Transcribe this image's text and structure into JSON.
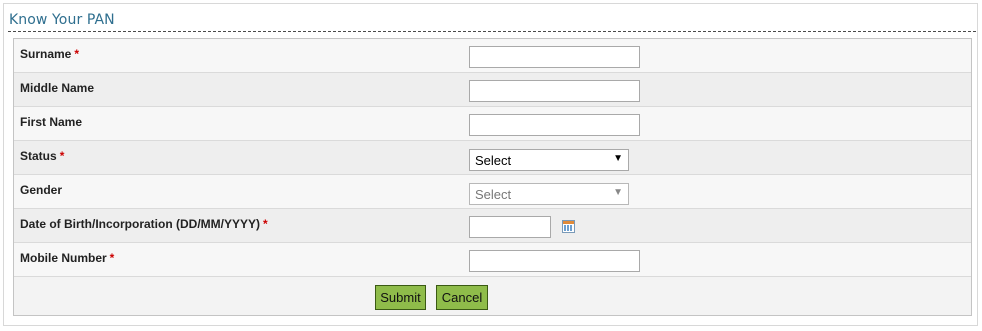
{
  "page": {
    "title": "Know Your PAN"
  },
  "form": {
    "surname": {
      "label": "Surname",
      "required_mark": "*",
      "value": ""
    },
    "middle_name": {
      "label": "Middle Name",
      "value": ""
    },
    "first_name": {
      "label": "First Name",
      "value": ""
    },
    "status": {
      "label": "Status",
      "required_mark": "*",
      "selected": "Select"
    },
    "gender": {
      "label": "Gender",
      "selected": "Select"
    },
    "dob": {
      "label": "Date of Birth/Incorporation (DD/MM/YYYY)",
      "required_mark": "*",
      "value": ""
    },
    "mobile": {
      "label": "Mobile Number",
      "required_mark": "*",
      "value": ""
    }
  },
  "buttons": {
    "submit_label": "Submit",
    "cancel_label": "Cancel"
  },
  "icons": {
    "dropdown_arrow": "▼",
    "calendar": "calendar-icon"
  },
  "colors": {
    "title": "#2f6f8f",
    "required": "#cc0000",
    "button_bg": "#8fbc4a",
    "button_border": "#3b5a14"
  }
}
